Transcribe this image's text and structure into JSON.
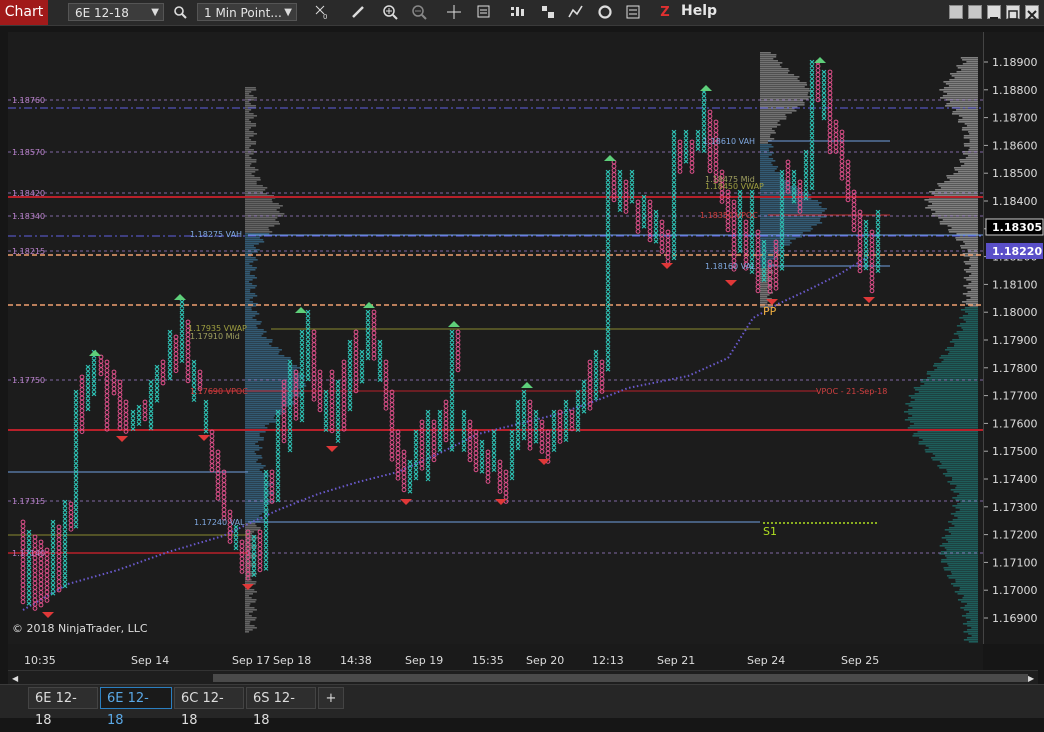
{
  "toolbar": {
    "title": "Chart",
    "instrument": "6E 12-18",
    "interval": "1 Min Point...",
    "help_label": "Help",
    "icons": [
      "search-icon",
      "crosshair-icon",
      "pencil-icon",
      "zoom-in-icon",
      "zoom-out-icon",
      "cursor-cross-icon",
      "data-box-icon",
      "bar-chart-icon",
      "strategies-icon",
      "indicators-icon",
      "refresh-icon",
      "properties-icon",
      "z-order-icon"
    ]
  },
  "price_axis": {
    "ticks": [
      "1.18900",
      "1.18800",
      "1.18700",
      "1.18600",
      "1.18500",
      "1.18400",
      "1.18300",
      "1.18200",
      "1.18100",
      "1.18000",
      "1.17900",
      "1.17800",
      "1.17700",
      "1.17600",
      "1.17500",
      "1.17400",
      "1.17300",
      "1.17200",
      "1.17100",
      "1.17000",
      "1.16900"
    ],
    "current_price": "1.18305",
    "vwap_price": "1.18220"
  },
  "time_axis": {
    "labels": [
      "10:35",
      "Sep 14",
      "Sep 17",
      "Sep 18",
      "14:38",
      "Sep 19",
      "15:35",
      "Sep 20",
      "12:13",
      "Sep 21",
      "Sep 24",
      "Sep 25"
    ]
  },
  "chart_labels": {
    "left_levels": [
      "1.18760",
      "1.18570",
      "1.18420",
      "1.18340",
      "1.18215",
      "1.17750",
      "1.17315",
      "1.17140"
    ],
    "vah_left": "1.18275 VAH",
    "vwap_left": "1.17935 VWAP",
    "mid_left": "1.17910 Mid",
    "vpoc_left": "1.17690 VPOC",
    "val_left": "1.17240 VAL",
    "vah_right": "1.18610 VAH",
    "mid_right": "1.18475 Mid",
    "vwap_right": "1.18450 VWAP",
    "vpoc_right": "1.18350 VPOC",
    "val_right": "1.18160 VAL",
    "pp": "PP",
    "s1": "S1",
    "vpoc_date": "VPOC - 21-Sep-18",
    "copyright": "© 2018 NinjaTrader, LLC"
  },
  "tabs": [
    {
      "label": "6E 12-18",
      "active": false
    },
    {
      "label": "6E 12-18",
      "active": true
    },
    {
      "label": "6C 12-18",
      "active": false
    },
    {
      "label": "6S 12-18",
      "active": false
    }
  ],
  "add_tab_label": "+",
  "colors": {
    "x_column": "#2ec4b6",
    "o_column": "#e0508c",
    "red_level": "#c0262d",
    "pp_line": "#f0a070",
    "vwap": "#6a5acd"
  }
}
